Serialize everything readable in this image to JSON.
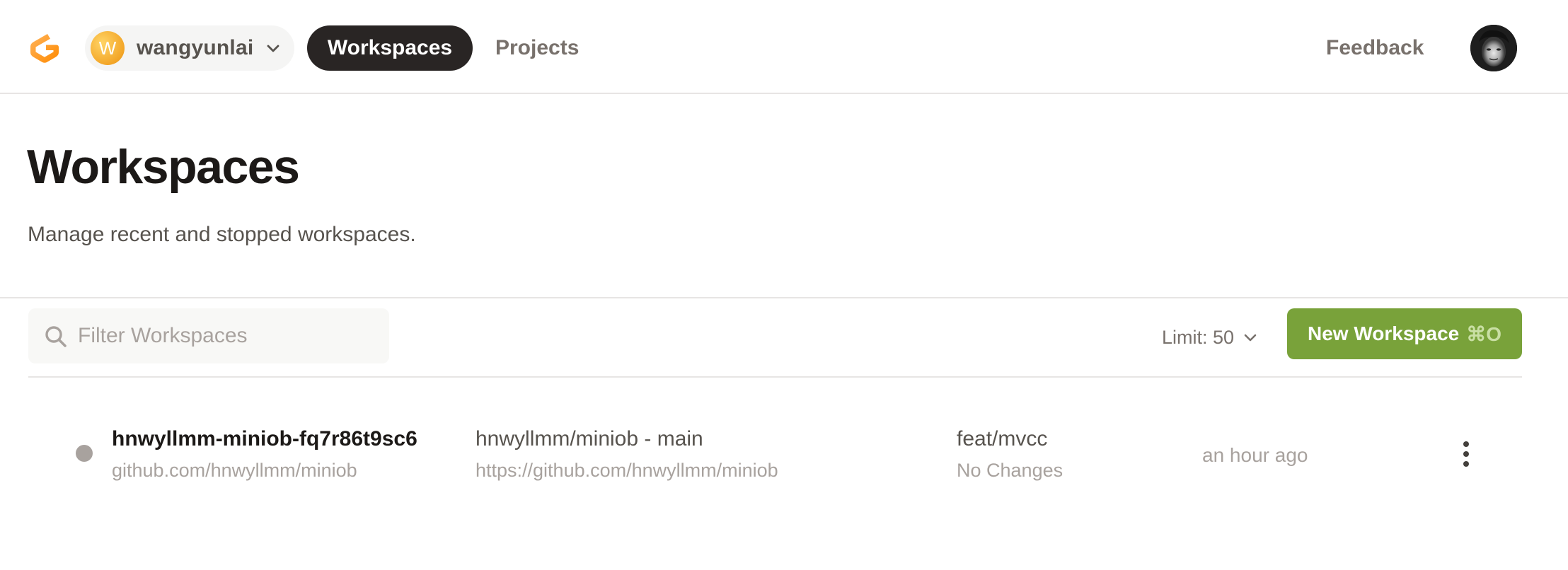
{
  "nav": {
    "org": {
      "avatar_letter": "W",
      "name": "wangyunlai"
    },
    "tabs": [
      {
        "label": "Workspaces",
        "active": true
      },
      {
        "label": "Projects",
        "active": false
      }
    ],
    "feedback_label": "Feedback"
  },
  "header": {
    "title": "Workspaces",
    "subtitle": "Manage recent and stopped workspaces."
  },
  "toolbar": {
    "search_placeholder": "Filter Workspaces",
    "limit_label": "Limit: 50",
    "new_workspace_label": "New Workspace",
    "new_workspace_shortcut": "⌘O"
  },
  "workspaces": [
    {
      "id": "hnwyllmm-miniob-fq7r86t9sc6",
      "repo": "github.com/hnwyllmm/miniob",
      "context_title": "hnwyllmm/miniob - main",
      "context_url": "https://github.com/hnwyllmm/miniob",
      "branch": "feat/mvcc",
      "changes": "No Changes",
      "last_active": "an hour ago",
      "status": "stopped"
    }
  ],
  "colors": {
    "accent_green": "#79a23a",
    "active_pill": "#292524",
    "status_stopped": "#a8a29e",
    "org_avatar": "#f3a628",
    "logo_orange": "#f59e0b"
  },
  "icons": {
    "logo": "gitpod-logo-icon",
    "org_chevron": "chevron-down-icon",
    "search": "search-icon",
    "limit_chevron": "chevron-down-icon",
    "row_menu": "more-vertical-icon"
  }
}
